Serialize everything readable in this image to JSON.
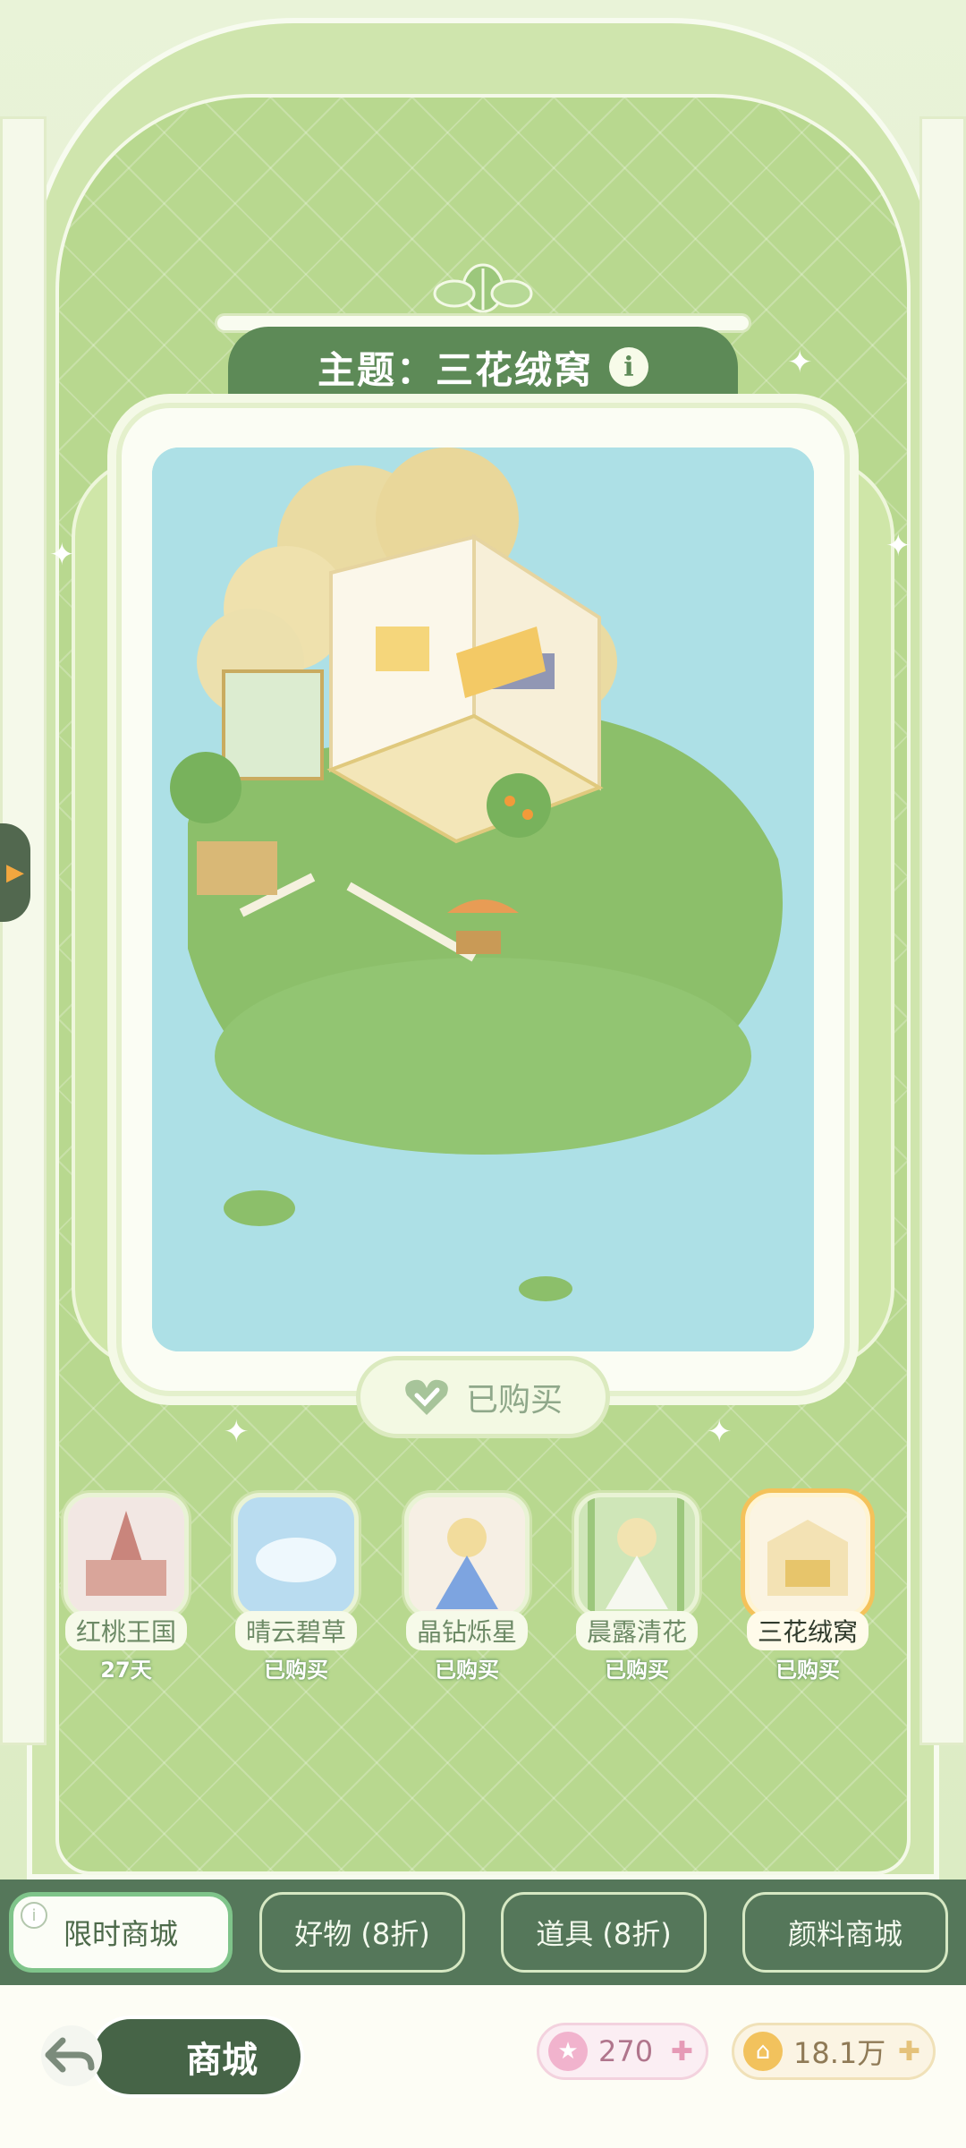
{
  "theme_title": "主题：三花绒窝",
  "purchase_status": "已购买",
  "themes": [
    {
      "name": "红桃王国",
      "status": "27天",
      "selected": false
    },
    {
      "name": "晴云碧草",
      "status": "已购买",
      "selected": false
    },
    {
      "name": "晶钻烁星",
      "status": "已购买",
      "selected": false
    },
    {
      "name": "晨露清花",
      "status": "已购买",
      "selected": false
    },
    {
      "name": "三花绒窝",
      "status": "已购买",
      "selected": true
    }
  ],
  "tabs": [
    {
      "label": "限时商城",
      "active": true
    },
    {
      "label": "好物 (8折)",
      "active": false
    },
    {
      "label": "道具 (8折)",
      "active": false
    },
    {
      "label": "颜料商城",
      "active": false
    }
  ],
  "back_label": "商城",
  "currencies": {
    "star": {
      "value": "270",
      "icon": "star-gem-icon"
    },
    "coin": {
      "value": "18.1万",
      "icon": "gold-coin-icon"
    }
  },
  "colors": {
    "accent_green": "#5d8a57",
    "tab_bar": "#55775a",
    "selected_border": "#f4c25a"
  }
}
